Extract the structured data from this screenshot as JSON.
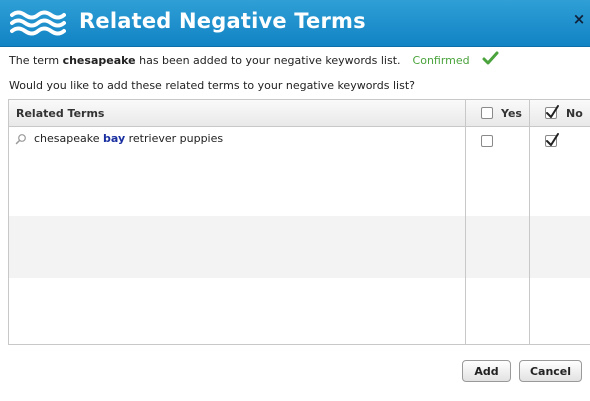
{
  "dialog": {
    "title": "Related Negative Terms",
    "close_label": "×"
  },
  "message": {
    "prefix": "The term ",
    "term": "chesapeake",
    "suffix": " has been added to your negative keywords list.",
    "status": "Confirmed",
    "question": "Would you like to add these related terms to your negative keywords list?"
  },
  "grid": {
    "columns": {
      "related": "Related Terms",
      "yes": "Yes",
      "no": "No"
    },
    "header_yes_checked": false,
    "header_no_checked": true,
    "rows": [
      {
        "before": "chesapeake ",
        "highlight": "bay",
        "after": " retriever puppies",
        "yes_checked": false,
        "no_checked": true
      }
    ]
  },
  "buttons": {
    "add": "Add",
    "cancel": "Cancel"
  },
  "colors": {
    "header_bg": "#1a8ccd",
    "confirmed": "#4aa33c",
    "highlight": "#1a2fa0"
  }
}
